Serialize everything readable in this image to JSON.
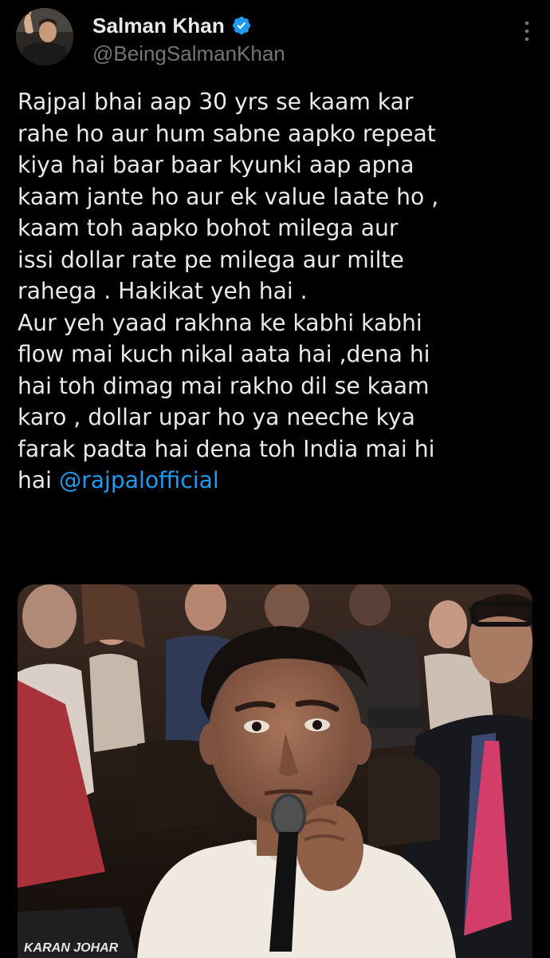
{
  "author": {
    "display_name": "Salman Khan",
    "handle": "@BeingSalmanKhan",
    "verified": true,
    "verified_color": "#1d9bf0"
  },
  "more_icon": "more-vertical-icon",
  "tweet": {
    "lines": [
      "Rajpal bhai aap 30 yrs se kaam kar",
      "rahe ho aur hum sabne aapko repeat",
      "kiya hai baar baar kyunki aap apna",
      "kaam jante ho aur ek value laate ho ,",
      "kaam toh aapko bohot milega aur",
      "issi dollar rate pe milega aur milte",
      "rahega . Hakikat yeh hai .",
      "Aur yeh yaad rakhna ke kabhi kabhi",
      "flow mai kuch nikal aata hai ,dena hi",
      "hai toh dimag mai rakho dil se kaam",
      "karo , dollar upar ho ya neeche kya",
      "farak padta hai dena toh India mai hi"
    ],
    "last_line_prefix": "hai ",
    "mention": "@rajpalofficial",
    "mention_color": "#1d9bf0"
  },
  "media": {
    "seat_label": "KARAN JOHAR"
  }
}
